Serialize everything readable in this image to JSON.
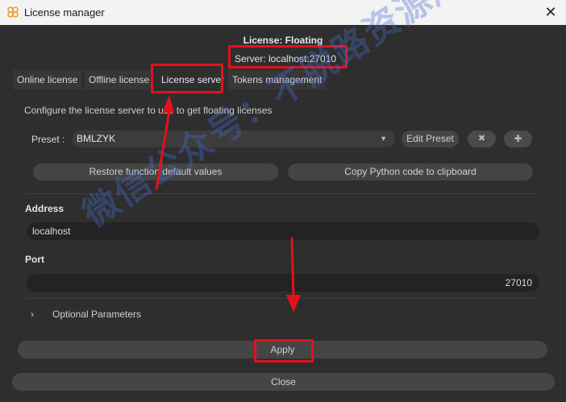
{
  "titlebar": {
    "title": "License manager",
    "close_glyph": "✕",
    "app_icon": "app-logo-icon"
  },
  "header": {
    "license_label": "License: Floating",
    "server_label": "Server: localhost:27010"
  },
  "tabs": [
    {
      "label": "Online license"
    },
    {
      "label": "Offline license"
    },
    {
      "label": "License server"
    },
    {
      "label": "Tokens management"
    }
  ],
  "description": "Configure the license server to use to get floating licenses",
  "preset": {
    "label": "Preset :",
    "value": "BMLZYK",
    "edit_button": "Edit Preset",
    "delete_glyph": "✖",
    "add_glyph": "✚"
  },
  "actions": {
    "restore_button": "Restore function default values",
    "copy_python_button": "Copy Python code to clipboard"
  },
  "address": {
    "label": "Address",
    "value": "localhost"
  },
  "port": {
    "label": "Port",
    "value": "27010"
  },
  "optional": {
    "chevron": "›",
    "label": "Optional Parameters"
  },
  "buttons": {
    "apply": "Apply",
    "close": "Close"
  },
  "watermark": "微信公众号：不脱路资源库",
  "colors": {
    "annotation_red": "#e2121c",
    "background": "#2e2e2e",
    "title_bar": "#f3f3f3"
  }
}
